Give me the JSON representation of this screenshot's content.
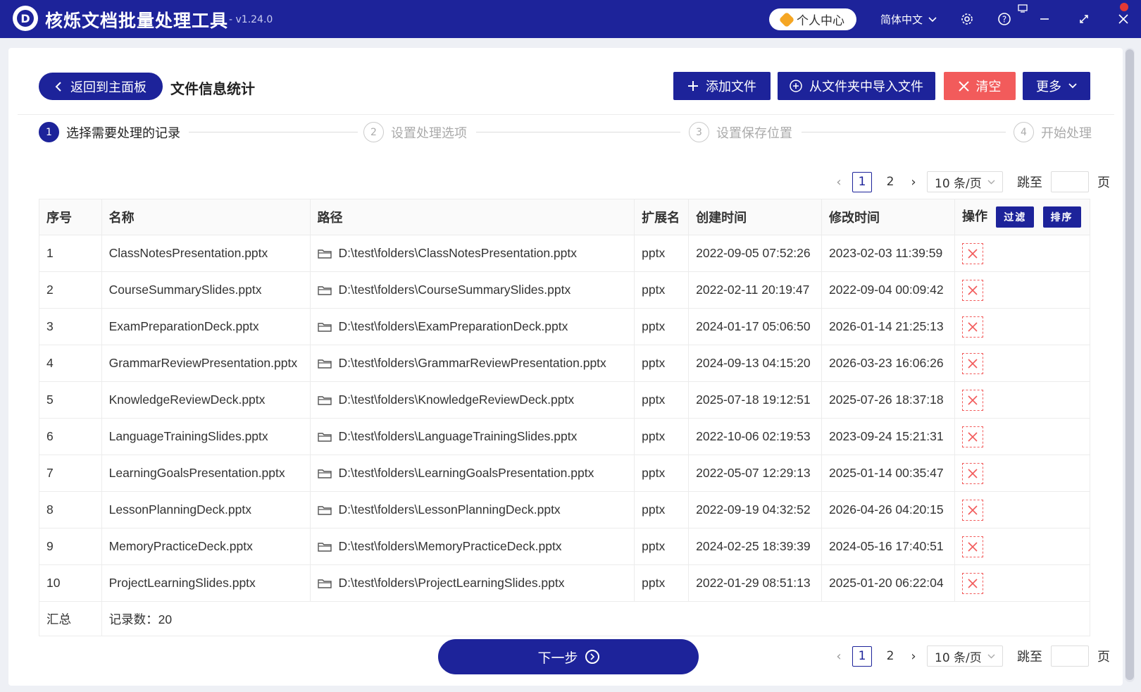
{
  "app": {
    "logo_letter": "D",
    "title": "核烁文档批量处理工具",
    "version": "- v1.24.0",
    "profile_label": "个人中心",
    "language": "简体中文"
  },
  "header": {
    "back_label": "返回到主面板",
    "page_title": "文件信息统计",
    "add_file": "添加文件",
    "import_folder": "从文件夹中导入文件",
    "clear": "清空",
    "more": "更多"
  },
  "steps": [
    {
      "num": "1",
      "label": "选择需要处理的记录"
    },
    {
      "num": "2",
      "label": "设置处理选项"
    },
    {
      "num": "3",
      "label": "设置保存位置"
    },
    {
      "num": "4",
      "label": "开始处理"
    }
  ],
  "pagination": {
    "pages": [
      "1",
      "2"
    ],
    "current_page": "1",
    "page_size": "10 条/页",
    "jump_label": "跳至",
    "page_unit": "页"
  },
  "table": {
    "columns": [
      "序号",
      "名称",
      "路径",
      "扩展名",
      "创建时间",
      "修改时间",
      "操作"
    ],
    "filter_label": "过滤",
    "sort_label": "排序",
    "rows": [
      {
        "idx": "1",
        "name": "ClassNotesPresentation.pptx",
        "path": "D:\\test\\folders\\ClassNotesPresentation.pptx",
        "ext": "pptx",
        "created": "2022-09-05 07:52:26",
        "modified": "2023-02-03 11:39:59"
      },
      {
        "idx": "2",
        "name": "CourseSummarySlides.pptx",
        "path": "D:\\test\\folders\\CourseSummarySlides.pptx",
        "ext": "pptx",
        "created": "2022-02-11 20:19:47",
        "modified": "2022-09-04 00:09:42"
      },
      {
        "idx": "3",
        "name": "ExamPreparationDeck.pptx",
        "path": "D:\\test\\folders\\ExamPreparationDeck.pptx",
        "ext": "pptx",
        "created": "2024-01-17 05:06:50",
        "modified": "2026-01-14 21:25:13"
      },
      {
        "idx": "4",
        "name": "GrammarReviewPresentation.pptx",
        "path": "D:\\test\\folders\\GrammarReviewPresentation.pptx",
        "ext": "pptx",
        "created": "2024-09-13 04:15:20",
        "modified": "2026-03-23 16:06:26"
      },
      {
        "idx": "5",
        "name": "KnowledgeReviewDeck.pptx",
        "path": "D:\\test\\folders\\KnowledgeReviewDeck.pptx",
        "ext": "pptx",
        "created": "2025-07-18 19:12:51",
        "modified": "2025-07-26 18:37:18"
      },
      {
        "idx": "6",
        "name": "LanguageTrainingSlides.pptx",
        "path": "D:\\test\\folders\\LanguageTrainingSlides.pptx",
        "ext": "pptx",
        "created": "2022-10-06 02:19:53",
        "modified": "2023-09-24 15:21:31"
      },
      {
        "idx": "7",
        "name": "LearningGoalsPresentation.pptx",
        "path": "D:\\test\\folders\\LearningGoalsPresentation.pptx",
        "ext": "pptx",
        "created": "2022-05-07 12:29:13",
        "modified": "2025-01-14 00:35:47"
      },
      {
        "idx": "8",
        "name": "LessonPlanningDeck.pptx",
        "path": "D:\\test\\folders\\LessonPlanningDeck.pptx",
        "ext": "pptx",
        "created": "2022-09-19 04:32:52",
        "modified": "2026-04-26 04:20:15"
      },
      {
        "idx": "9",
        "name": "MemoryPracticeDeck.pptx",
        "path": "D:\\test\\folders\\MemoryPracticeDeck.pptx",
        "ext": "pptx",
        "created": "2024-02-25 18:39:39",
        "modified": "2024-05-16 17:40:51"
      },
      {
        "idx": "10",
        "name": "ProjectLearningSlides.pptx",
        "path": "D:\\test\\folders\\ProjectLearningSlides.pptx",
        "ext": "pptx",
        "created": "2022-01-29 08:51:13",
        "modified": "2025-01-20 06:22:04"
      }
    ],
    "summary_label": "汇总",
    "summary_value": "记录数：20"
  },
  "footer": {
    "next_label": "下一步"
  },
  "colors": {
    "brand": "#1d239a",
    "danger": "#f25b5b"
  }
}
